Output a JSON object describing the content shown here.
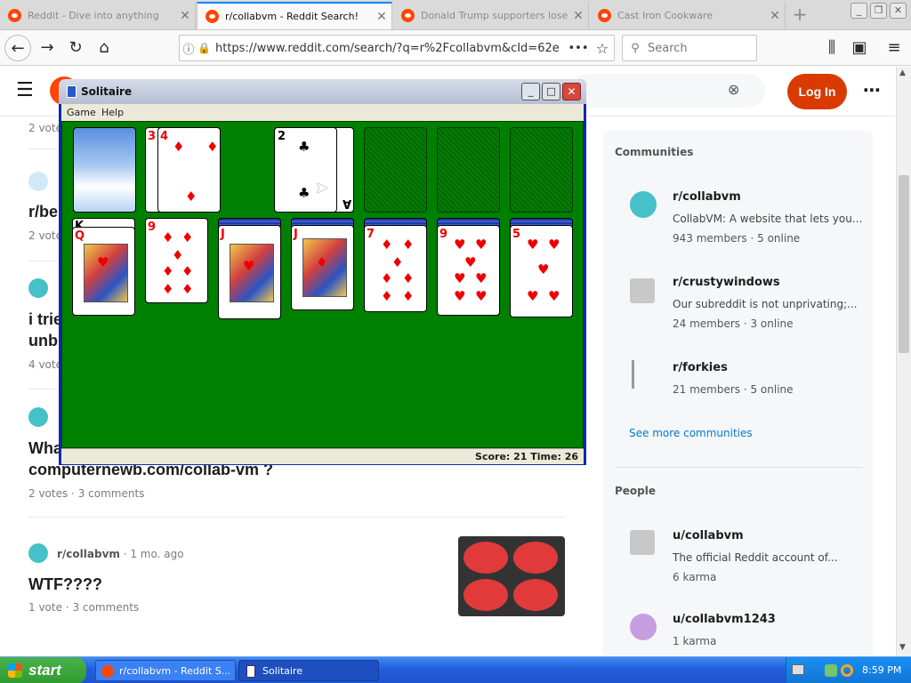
{
  "browser": {
    "tabs": [
      {
        "title": "Reddit - Dive into anything",
        "active": false
      },
      {
        "title": "r/collabvm - Reddit Search!",
        "active": true
      },
      {
        "title": "Donald Trump supporters lose &",
        "active": false
      },
      {
        "title": "Cast Iron Cookware",
        "active": false
      }
    ],
    "url": "https://www.reddit.com/search/?q=r%2Fcollabvm&cId=62e",
    "search_placeholder": "Search"
  },
  "reddit": {
    "login_label": "Log In",
    "posts": [
      {
        "meta": "2 votes",
        "title": ""
      },
      {
        "sub": "r/be",
        "meta": "2 votes"
      },
      {
        "title_a": "i trie",
        "title_b": "unb",
        "meta": "4 votes"
      },
      {
        "title_a": "Wha",
        "title_b": "computernewb.com/collab-vm ?",
        "votes": "2 votes",
        "comments": "3 comments"
      },
      {
        "sub": "r/collabvm",
        "age": "1 mo. ago",
        "title": "WTF????",
        "votes": "1 vote",
        "comments": "3 comments"
      }
    ],
    "sidebar": {
      "communities_heading": "Communities",
      "communities": [
        {
          "name": "r/collabvm",
          "desc": "CollabVM: A website that lets you...",
          "members": "943 members",
          "online": "5 online"
        },
        {
          "name": "r/crustywindows",
          "desc": "Our subreddit is not unprivating;...",
          "members": "24 members",
          "online": "3 online"
        },
        {
          "name": "r/forkies",
          "members": "21 members",
          "online": "5 online"
        }
      ],
      "see_more": "See more communities",
      "people_heading": "People",
      "people": [
        {
          "name": "u/collabvm",
          "desc": "The official Reddit account of...",
          "karma": "6 karma"
        },
        {
          "name": "u/collabvm1243",
          "karma": "1 karma"
        }
      ]
    }
  },
  "solitaire": {
    "title": "Solitaire",
    "menu": [
      "Game",
      "Help"
    ],
    "status": "Score: 21 Time: 26",
    "waste": [
      {
        "rank": "3",
        "suit": "♦"
      },
      {
        "rank": "4",
        "suit": "♦"
      }
    ],
    "foundation_card": {
      "rank": "2",
      "suit": "♣",
      "under": "A"
    },
    "tableau": [
      {
        "rank": "Q",
        "suit": "♥",
        "under": "K"
      },
      {
        "rank": "9",
        "suit": "♦"
      },
      {
        "rank": "J",
        "suit": "♥"
      },
      {
        "rank": "J",
        "suit": "♦"
      },
      {
        "rank": "7",
        "suit": "♦"
      },
      {
        "rank": "9",
        "suit": "♥"
      },
      {
        "rank": "5",
        "suit": "♥"
      }
    ]
  },
  "taskbar": {
    "start_label": "start",
    "buttons": [
      "r/collabvm - Reddit S...",
      "Solitaire"
    ],
    "clock": "8:59 PM"
  }
}
